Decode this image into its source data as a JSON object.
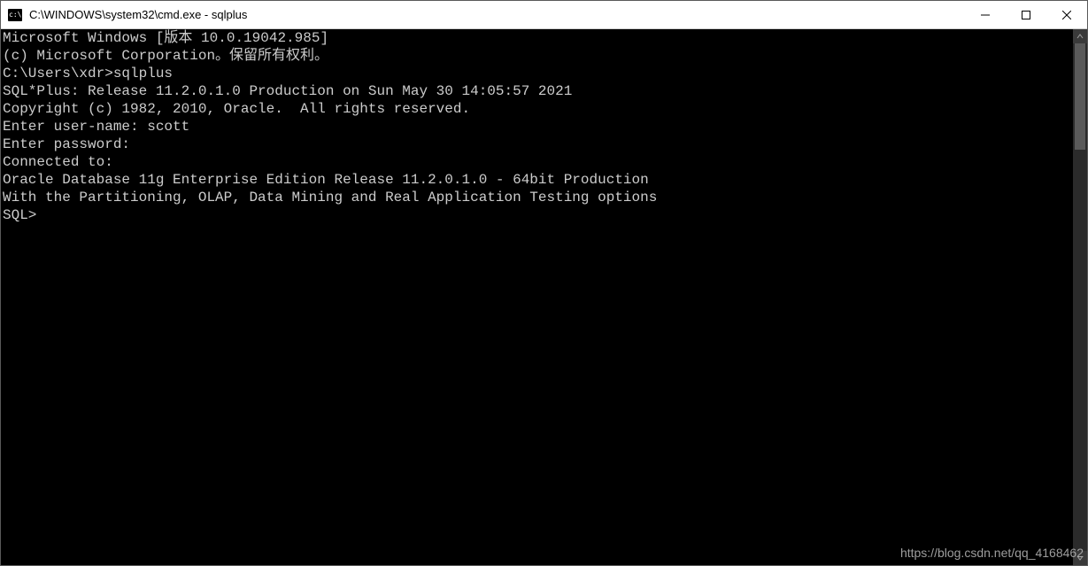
{
  "window": {
    "title": "C:\\WINDOWS\\system32\\cmd.exe - sqlplus"
  },
  "terminal": {
    "lines": [
      "Microsoft Windows [版本 10.0.19042.985]",
      "(c) Microsoft Corporation。保留所有权利。",
      "",
      "C:\\Users\\xdr>sqlplus",
      "",
      "SQL*Plus: Release 11.2.0.1.0 Production on Sun May 30 14:05:57 2021",
      "",
      "Copyright (c) 1982, 2010, Oracle.  All rights reserved.",
      "",
      "Enter user-name: scott",
      "Enter password:",
      "",
      "Connected to:",
      "Oracle Database 11g Enterprise Edition Release 11.2.0.1.0 - 64bit Production",
      "With the Partitioning, OLAP, Data Mining and Real Application Testing options",
      "",
      "SQL>"
    ]
  },
  "watermark": "https://blog.csdn.net/qq_4168462"
}
